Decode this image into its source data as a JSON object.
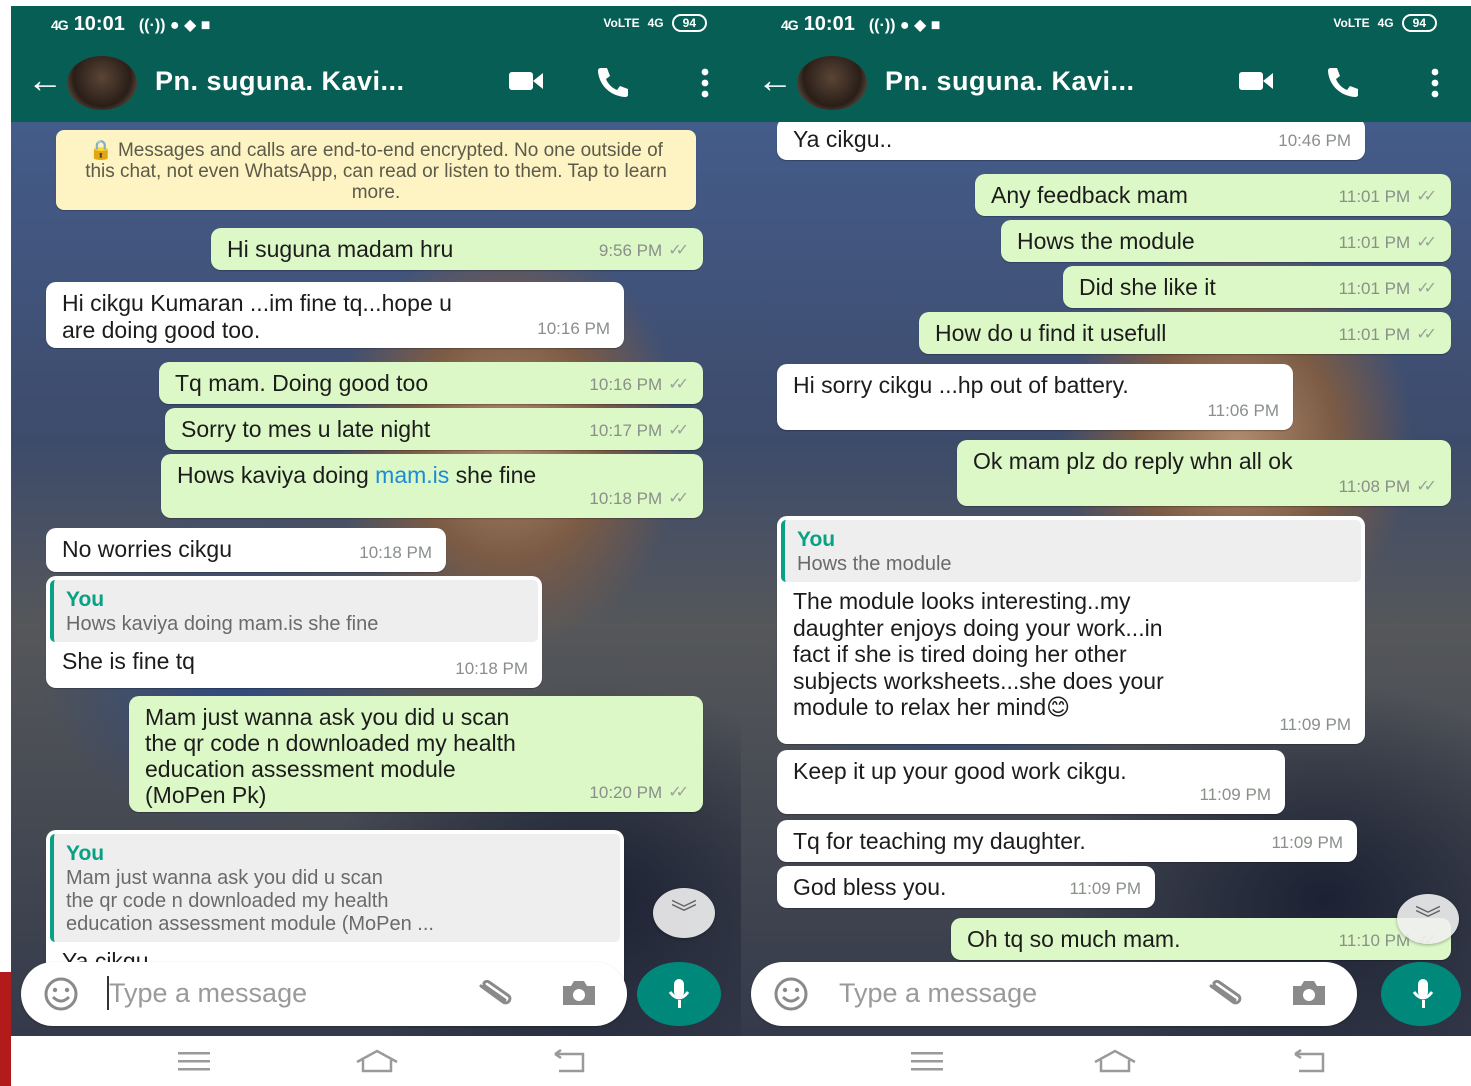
{
  "status": {
    "signal": "4G",
    "time": "10:01",
    "network": "4G",
    "volte": "VoLTE",
    "battery": "94"
  },
  "left": {
    "contact": "Pn. suguna. Kavi...",
    "encryption": "🔒 Messages and calls are end-to-end encrypted. No one outside of this chat, not even WhatsApp, can read or listen to them. Tap to learn more.",
    "messages": [
      {
        "text": "Hi suguna madam hru",
        "time": "9:56 PM"
      },
      {
        "text": "Hi cikgu Kumaran ...im fine tq...hope u\nare doing good too.",
        "time": "10:16 PM"
      },
      {
        "text": "Tq mam. Doing good too",
        "time": "10:16 PM"
      },
      {
        "text": "Sorry to mes u late night",
        "time": "10:17 PM"
      },
      {
        "text_before": "Hows kaviya doing ",
        "link": "mam.is",
        "text_after": " she fine",
        "time": "10:18 PM"
      },
      {
        "text": "No worries cikgu",
        "time": "10:18 PM"
      },
      {
        "quote_name": "You",
        "quote_text": "Hows kaviya doing mam.is she fine",
        "text": "She is fine tq",
        "time": "10:18 PM"
      },
      {
        "text": "Mam just wanna ask you did u scan\nthe qr code n downloaded my health\neducation assessment module\n(MoPen Pk)",
        "time": "10:20 PM"
      },
      {
        "quote_name": "You",
        "quote_text": "Mam just wanna ask you did u scan\nthe qr code n downloaded my health\neducation assessment module (MoPen ...",
        "text": "Ya cikgu.."
      }
    ],
    "placeholder": "Type a message"
  },
  "right": {
    "contact": "Pn. suguna. Kavi...",
    "messages": [
      {
        "text": "Ya cikgu..",
        "time": "10:46 PM"
      },
      {
        "text": "Any feedback mam",
        "time": "11:01 PM"
      },
      {
        "text": "Hows the module",
        "time": "11:01 PM"
      },
      {
        "text": "Did she like it",
        "time": "11:01 PM"
      },
      {
        "text": "How do u find it usefull",
        "time": "11:01 PM"
      },
      {
        "text": "Hi sorry cikgu ...hp out of battery.",
        "time": "11:06 PM"
      },
      {
        "text": "Ok mam plz do reply whn all ok",
        "time": "11:08 PM"
      },
      {
        "quote_name": "You",
        "quote_text": "Hows the module",
        "text": "The module looks interesting..my\ndaughter enjoys doing your work...in\nfact if she is tired doing her other\nsubjects worksheets...she does your\nmodule to relax her mind😊",
        "time": "11:09 PM"
      },
      {
        "text": "Keep it up your good work cikgu.",
        "time": "11:09 PM"
      },
      {
        "text": "Tq for teaching my daughter.",
        "time": "11:09 PM"
      },
      {
        "text": "God bless you.",
        "time": "11:09 PM"
      },
      {
        "text": "Oh tq so much mam.",
        "time": "11:10 PM"
      }
    ],
    "placeholder": "Type a message"
  },
  "icons": [
    "back-arrow-icon",
    "video-call-icon",
    "voice-call-icon",
    "more-options-icon",
    "emoji-icon",
    "attach-icon",
    "camera-icon",
    "mic-icon",
    "scroll-down-icon",
    "menu-icon",
    "home-icon",
    "back-nav-icon"
  ],
  "colors": {
    "header": "#075e54",
    "outgoing": "#dcf8c6",
    "incoming": "#ffffff",
    "mic": "#00897b",
    "quote_accent": "#08a183",
    "link": "#1c8bd6"
  }
}
